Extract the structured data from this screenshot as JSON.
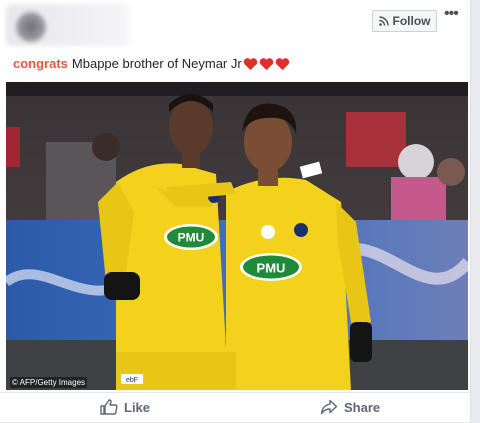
{
  "post": {
    "follow_label": "Follow",
    "more_label": "•••",
    "caption_highlight": "congrats",
    "caption_text": "Mbappe brother of Neymar Jr",
    "hearts": 3,
    "photo_credit": "© AFP/Getty Images",
    "shirt_sponsor": "PMU",
    "sleeve_logo": "ebF"
  },
  "actions": {
    "like_label": "Like",
    "share_label": "Share"
  },
  "colors": {
    "highlight": "#e9573d",
    "heart": "#e0302c",
    "kit_yellow": "#f2d21c",
    "sponsor_green": "#1f8a3a"
  },
  "icons": {
    "follow": "rss-icon",
    "like": "thumbs-up-icon",
    "share": "share-arrow-icon"
  }
}
